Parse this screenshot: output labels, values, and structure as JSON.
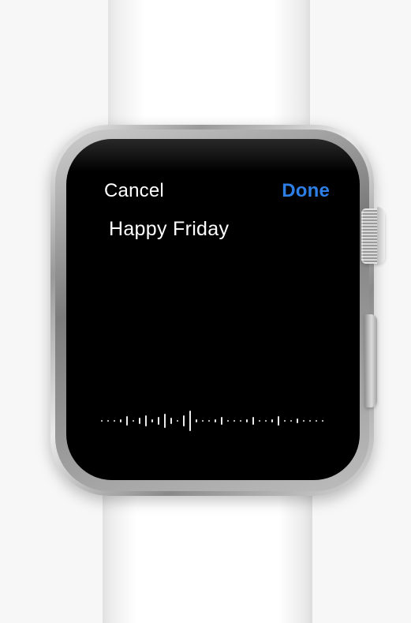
{
  "screen": {
    "cancel_label": "Cancel",
    "done_label": "Done",
    "dictated_text": "Happy Friday"
  },
  "colors": {
    "done_accent": "#2d7fe6",
    "screen_background": "#000000",
    "text": "#ffffff"
  },
  "icons": {
    "waveform": "dictation-waveform-icon"
  }
}
